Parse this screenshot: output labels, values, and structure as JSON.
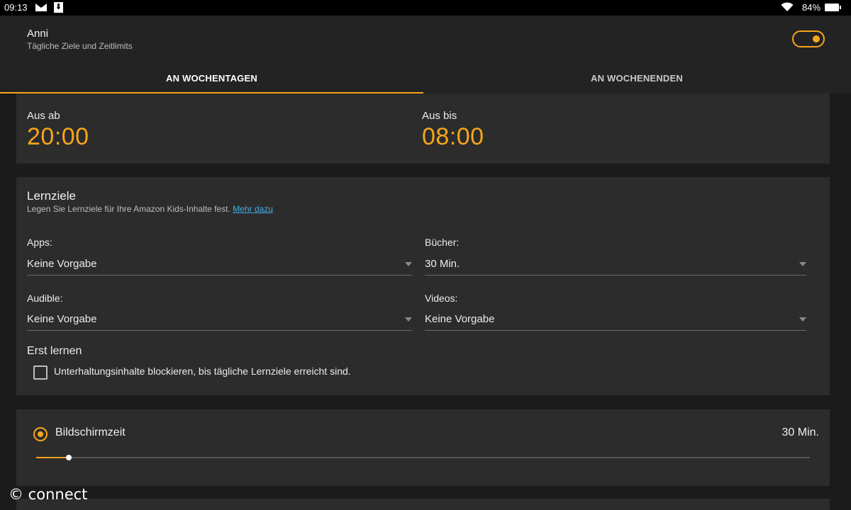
{
  "status_bar": {
    "time": "09:13",
    "battery": "84%",
    "icons": [
      "mail-icon",
      "download-icon",
      "wifi-icon",
      "battery-icon"
    ]
  },
  "header": {
    "profile_name": "Anni",
    "profile_subtitle": "Tägliche Ziele und Zeitlimits",
    "toggle_on": true
  },
  "tabs": [
    {
      "label": "AN WOCHENTAGEN",
      "active": true
    },
    {
      "label": "AN WOCHENENDEN",
      "active": false
    }
  ],
  "bedtime": {
    "off_from_label": "Aus ab",
    "off_from_value": "20:00",
    "off_until_label": "Aus bis",
    "off_until_value": "08:00"
  },
  "goals": {
    "title": "Lernziele",
    "description": "Legen Sie Lernziele für Ihre Amazon Kids-Inhalte fest.",
    "link": "Mehr dazu",
    "fields": {
      "apps_label": "Apps:",
      "apps_value": "Keine Vorgabe",
      "books_label": "Bücher:",
      "books_value": "30 Min.",
      "audible_label": "Audible:",
      "audible_value": "Keine Vorgabe",
      "videos_label": "Videos:",
      "videos_value": "Keine Vorgabe"
    },
    "learn_first_title": "Erst lernen",
    "learn_first_checkbox": "Unterhaltungsinhalte blockieren, bis tägliche Lernziele erreicht sind.",
    "learn_first_checked": false
  },
  "screen_time": {
    "label": "Bildschirmzeit",
    "value": "30 Min.",
    "slider_fraction": 0.042
  },
  "watermark": "© connect",
  "colors": {
    "accent": "#f7a51c",
    "link": "#41b0e8",
    "background": "#1b1b1b",
    "card": "#2c2c2c"
  }
}
